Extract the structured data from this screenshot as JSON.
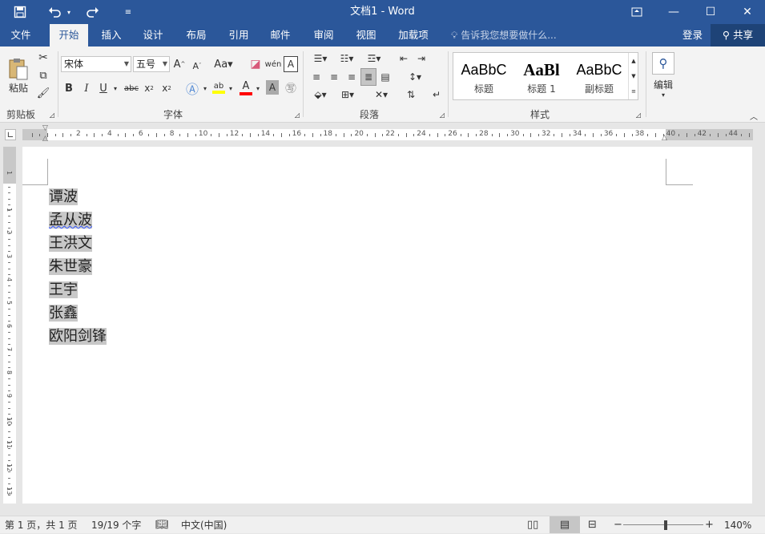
{
  "titlebar": {
    "title": "文档1 - Word",
    "qa_icons": [
      "save-icon",
      "undo-icon",
      "redo-icon",
      "customize-qa-icon"
    ],
    "window_buttons": {
      "restore_ribbon": "⧉",
      "minimize": "—",
      "maximize": "☐",
      "close": "✕"
    }
  },
  "tabs": [
    {
      "label": "文件"
    },
    {
      "label": "开始"
    },
    {
      "label": "插入"
    },
    {
      "label": "设计"
    },
    {
      "label": "布局"
    },
    {
      "label": "引用"
    },
    {
      "label": "邮件"
    },
    {
      "label": "审阅"
    },
    {
      "label": "视图"
    },
    {
      "label": "加载项"
    }
  ],
  "tellme": "告诉我您想要做什么...",
  "login": "登录",
  "share": "共享",
  "ribbon": {
    "clipboard": {
      "paste": "粘贴",
      "label": "剪贴板"
    },
    "font": {
      "name": "宋体",
      "size": "五号",
      "label": "字体"
    },
    "paragraph": {
      "label": "段落"
    },
    "styles": {
      "label": "样式",
      "items": [
        {
          "preview": "AaBbC",
          "name": "标题"
        },
        {
          "preview": "AaBl",
          "name": "标题 1"
        },
        {
          "preview": "AaBbC",
          "name": "副标题"
        }
      ]
    },
    "editing": {
      "label": "编辑"
    }
  },
  "ruler": {
    "numbers": [
      "2",
      "4",
      "6",
      "8",
      "10",
      "12",
      "14",
      "16",
      "18",
      "20",
      "22",
      "24",
      "26",
      "28",
      "30",
      "32",
      "34",
      "36",
      "38",
      "40",
      "42",
      "44"
    ],
    "vnumbers": [
      "1",
      "1",
      "2",
      "3",
      "4",
      "5",
      "6",
      "7",
      "8",
      "9",
      "10",
      "11",
      "12",
      "13"
    ]
  },
  "document": {
    "lines": [
      "谭波",
      "孟从波",
      "王洪文",
      "朱世豪",
      "王宇",
      "张鑫",
      "欧阳剑锋"
    ]
  },
  "status": {
    "page": "第 1 页，共 1 页",
    "words": "19/19 个字",
    "lang": "中文(中国)",
    "zoom": "140%"
  },
  "colors": {
    "accent": "#2b579a",
    "highlight": "#ffff00",
    "font_color": "#ff0000"
  }
}
